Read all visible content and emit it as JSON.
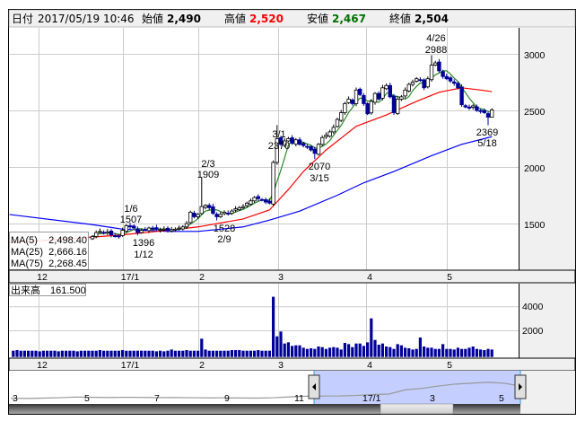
{
  "header": {
    "date_label": "日付",
    "date_value": "2017/05/19 10:46",
    "open_label": "始値",
    "open_value": "2,490",
    "high_label": "高値",
    "high_value": "2,520",
    "low_label": "安値",
    "low_value": "2,467",
    "close_label": "終値",
    "close_value": "2,504"
  },
  "legend": {
    "ma5_label": "MA(5)",
    "ma5_value": "2,498.40",
    "ma25_label": "MA(25)",
    "ma25_value": "2,666.16",
    "ma75_label": "MA(75)",
    "ma75_value": "2,268.45"
  },
  "volume_legend": {
    "label": "出来高",
    "value": "161.500"
  },
  "colors": {
    "up": "#ffffff",
    "down": "#000099",
    "ma5": "#2a8a2a",
    "ma25": "#ff0000",
    "ma75": "#0000ff",
    "volume": "#000099",
    "high_text": "#ff0000",
    "low_text": "#007000",
    "nav_fill": "#c4ceff"
  },
  "price_axis": {
    "ticks": [
      "3000",
      "2500",
      "2000",
      "1500"
    ]
  },
  "volume_axis": {
    "ticks": [
      "4000",
      "2000"
    ]
  },
  "date_axis": [
    "12",
    "17/1",
    "2",
    "3",
    "4",
    "5"
  ],
  "navigator_axis": [
    "3",
    "5",
    "7",
    "9",
    "11",
    "17/1",
    "3",
    "5"
  ],
  "annotations": {
    "a426": [
      "4/26",
      "2988"
    ],
    "a301": [
      "3/1",
      "2370"
    ],
    "a203": [
      "2/3",
      "1909"
    ],
    "a106": [
      "1/6",
      "1507"
    ],
    "a112": [
      "1396",
      "1/12"
    ],
    "a209": [
      "1528",
      "2/9"
    ],
    "a315": [
      "2070",
      "3/15"
    ],
    "a518": [
      "2369",
      "5/18"
    ]
  },
  "chart_data": {
    "type": "candlestick",
    "price_range": [
      1100,
      3300
    ],
    "closes": [
      1385,
      1420,
      1430,
      1415,
      1425,
      1400,
      1390,
      1385,
      1440,
      1480,
      1470,
      1460,
      1420,
      1440,
      1445,
      1460,
      1455,
      1450,
      1445,
      1450,
      1440,
      1445,
      1450,
      1460,
      1470,
      1500,
      1600,
      1560,
      1580,
      1650,
      1660,
      1640,
      1590,
      1560,
      1580,
      1600,
      1590,
      1610,
      1630,
      1640,
      1650,
      1680,
      1700,
      1730,
      1720,
      1710,
      1690,
      1680,
      2040,
      2250,
      2200,
      2230,
      2250,
      2210,
      2240,
      2200,
      2190,
      2180,
      2150,
      2120,
      2200,
      2260,
      2280,
      2310,
      2350,
      2420,
      2480,
      2560,
      2600,
      2560,
      2680,
      2640,
      2560,
      2470,
      2580,
      2650,
      2600,
      2700,
      2720,
      2620,
      2480,
      2600,
      2620,
      2680,
      2730,
      2750,
      2780,
      2770,
      2700,
      2780,
      2900,
      2920,
      2850,
      2800,
      2780,
      2760,
      2740,
      2700,
      2550,
      2530,
      2520,
      2540,
      2500,
      2490,
      2480,
      2440,
      2504
    ],
    "special_highs": {
      "10": 1507,
      "29": 1909,
      "49": 2370,
      "90": 2988,
      "106": 2520
    },
    "special_lows": {
      "12": 1396,
      "33": 1528,
      "59": 2070,
      "105": 2369,
      "106": 2467
    },
    "ma25": [
      [
        -22,
        1330
      ],
      [
        0,
        1380
      ],
      [
        8,
        1400
      ],
      [
        20,
        1440
      ],
      [
        28,
        1470
      ],
      [
        40,
        1540
      ],
      [
        47,
        1620
      ],
      [
        52,
        1800
      ],
      [
        56,
        1960
      ],
      [
        62,
        2150
      ],
      [
        70,
        2360
      ],
      [
        78,
        2460
      ],
      [
        86,
        2580
      ],
      [
        92,
        2660
      ],
      [
        98,
        2700
      ],
      [
        103,
        2680
      ],
      [
        106,
        2666
      ]
    ],
    "ma75": [
      [
        -22,
        1580
      ],
      [
        0,
        1490
      ],
      [
        8,
        1450
      ],
      [
        20,
        1430
      ],
      [
        28,
        1430
      ],
      [
        40,
        1470
      ],
      [
        47,
        1530
      ],
      [
        55,
        1610
      ],
      [
        65,
        1750
      ],
      [
        72,
        1860
      ],
      [
        80,
        1960
      ],
      [
        90,
        2100
      ],
      [
        98,
        2200
      ],
      [
        106,
        2268
      ]
    ],
    "volumes": [
      300,
      350,
      300,
      300,
      300,
      300,
      300,
      250,
      300,
      300,
      300,
      300,
      250,
      300,
      300,
      300,
      300,
      250,
      300,
      300,
      300,
      300,
      300,
      350,
      300,
      300,
      300,
      300,
      300,
      350,
      300,
      300,
      300,
      300,
      300,
      300,
      300,
      300,
      250,
      300,
      250,
      300,
      400,
      300,
      300,
      300,
      350,
      300,
      300,
      300,
      1300,
      400,
      300,
      300,
      300,
      300,
      300,
      300,
      350,
      350,
      350,
      300,
      300,
      300,
      300,
      350,
      300,
      300,
      300,
      4800,
      1500,
      1900,
      900,
      1000,
      700,
      750,
      750,
      550,
      450,
      500,
      450,
      650,
      600,
      450,
      550,
      600,
      550,
      400,
      950,
      850,
      600,
      900,
      900,
      700,
      1000,
      3000,
      1200,
      800,
      900,
      650,
      600,
      450,
      850,
      750,
      550,
      500,
      400,
      450,
      1400,
      650,
      550,
      550,
      450,
      450,
      850,
      450,
      450,
      400,
      550,
      450,
      450,
      550,
      650,
      450,
      400,
      350,
      450,
      400
    ],
    "volume_start_index": -21,
    "navigator": [
      1200,
      1180,
      1220,
      1260,
      1330,
      1300,
      1280,
      1310,
      1290,
      1270,
      1280,
      1260,
      1240,
      1250,
      1230,
      1220,
      1260,
      1350,
      1420,
      1440,
      1450,
      1500,
      1600,
      1650,
      2100,
      2250,
      2500,
      2700,
      2800,
      2900,
      2800,
      2500
    ]
  }
}
